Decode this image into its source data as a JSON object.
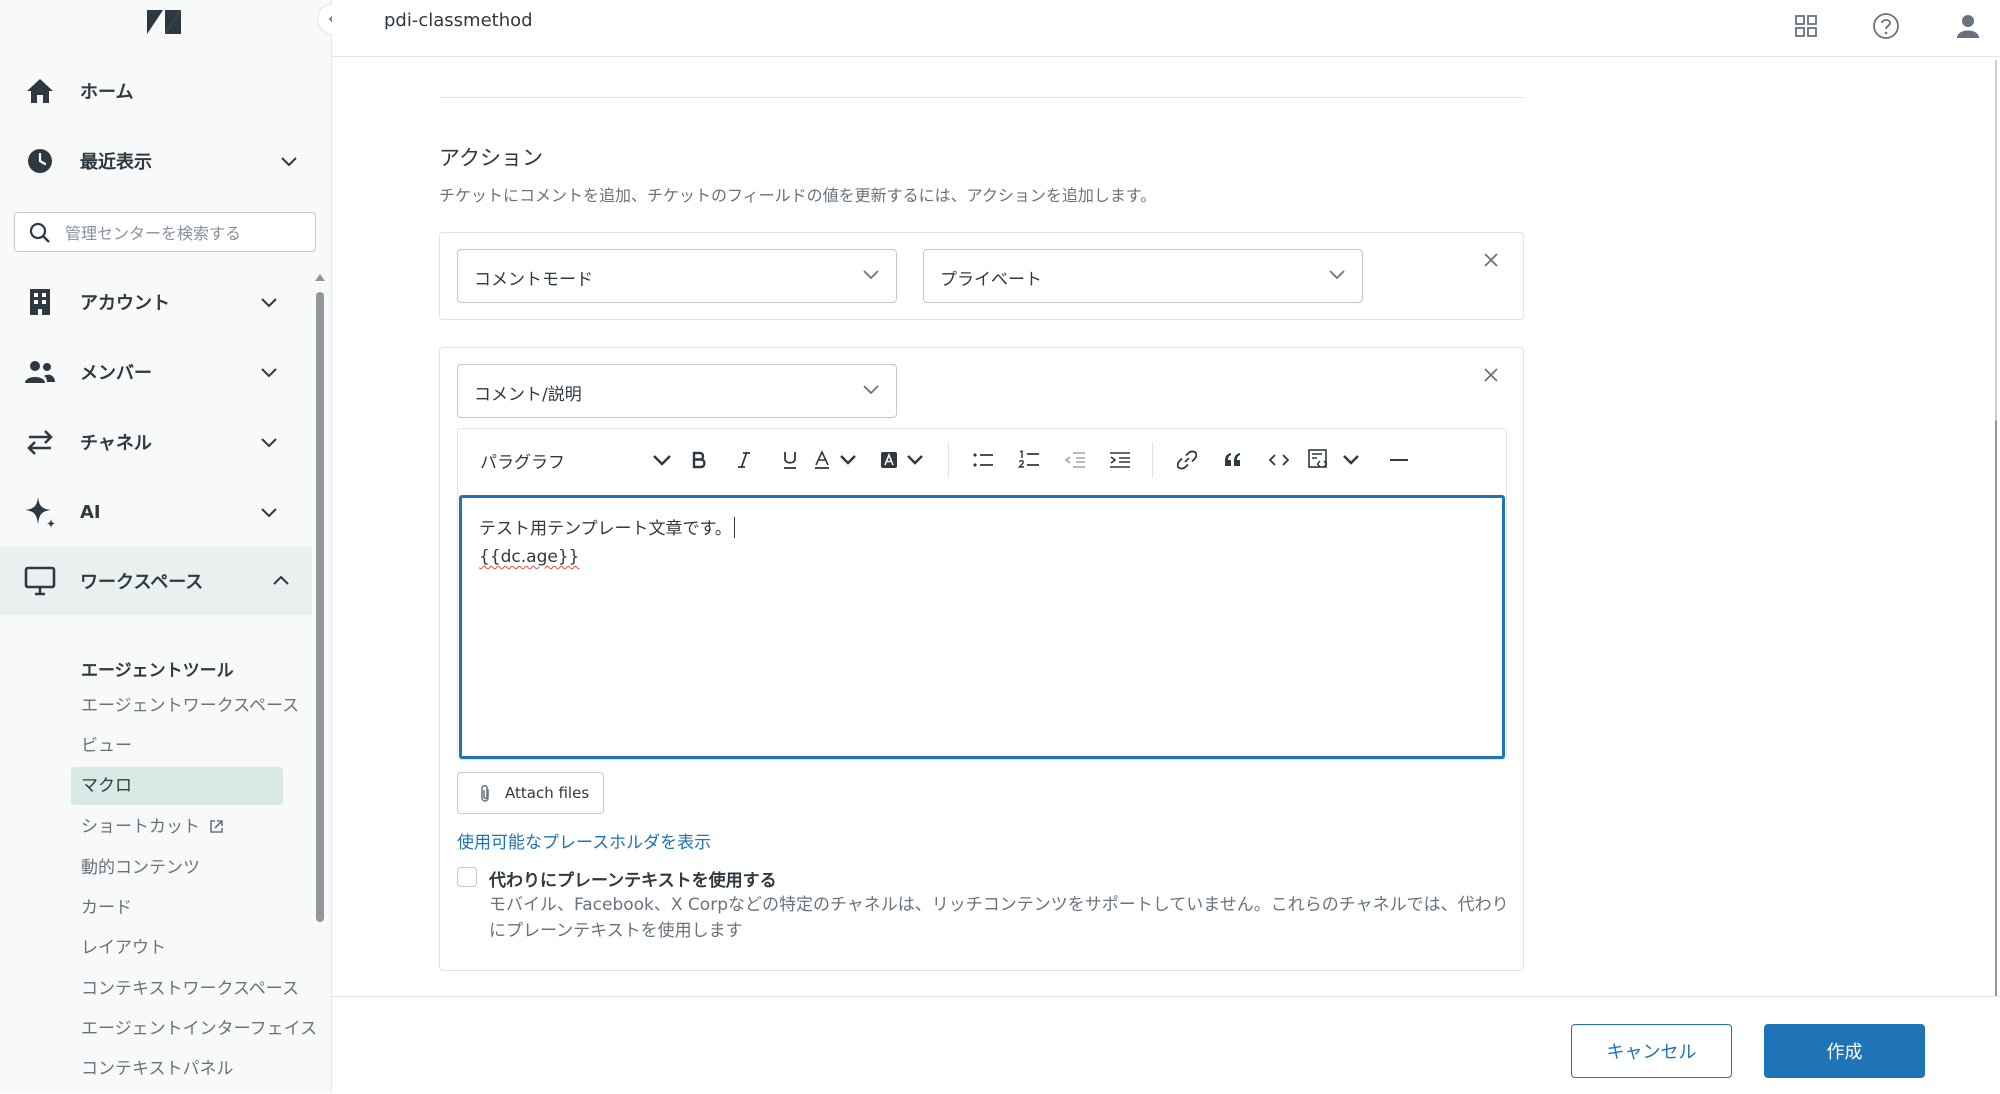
{
  "header": {
    "account_name": "pdi-classmethod",
    "icons": [
      "products-grid-icon",
      "help-icon",
      "user-profile-icon"
    ]
  },
  "sidebar": {
    "home_label": "ホーム",
    "recent_label": "最近表示",
    "search_placeholder": "管理センターを検索する",
    "items": [
      {
        "label": "アカウント",
        "icon": "building-icon"
      },
      {
        "label": "メンバー",
        "icon": "people-icon"
      },
      {
        "label": "チャネル",
        "icon": "arrows-swap-icon"
      },
      {
        "label": "AI",
        "icon": "sparkle-icon"
      },
      {
        "label": "ワークスペース",
        "icon": "monitor-icon"
      }
    ],
    "subsection_title": "エージェントツール",
    "sub_items": [
      {
        "label": "エージェントワークスペース"
      },
      {
        "label": "ビュー"
      },
      {
        "label": "マクロ",
        "active": true
      },
      {
        "label": "ショートカット"
      },
      {
        "label": "動的コンテンツ"
      },
      {
        "label": "カード"
      },
      {
        "label": "レイアウト"
      },
      {
        "label": "コンテキストワークスペース"
      },
      {
        "label": "エージェントインターフェイス"
      },
      {
        "label": "コンテキストパネル"
      }
    ]
  },
  "actions": {
    "title": "アクション",
    "description": "チケットにコメントを追加、チケットのフィールドの値を更新するには、アクションを追加します。",
    "rows": [
      {
        "field": "コメントモード",
        "value": "プライベート"
      },
      {
        "field": "コメント/説明"
      }
    ]
  },
  "editor": {
    "block_format": "パラグラフ",
    "content_line1": "テスト用テンプレート文章です。",
    "content_line2": "{{dc.age}}",
    "attach_label": "Attach files",
    "placeholder_link": "使用可能なプレースホルダを表示",
    "plain_text_label": "代わりにプレーンテキストを使用する",
    "plain_text_checked": false,
    "plain_text_hint": "モバイル、Facebook、X Corpなどの特定のチャネルは、リッチコンテンツをサポートしていません。これらのチャネルでは、代わりにプレーンテキストを使用します"
  },
  "footer": {
    "cancel_label": "キャンセル",
    "create_label": "作成"
  },
  "colors": {
    "accent": "#1f73b7",
    "text": "#2f3941",
    "muted": "#68737d",
    "active_sub_item": "#d8eae5"
  }
}
